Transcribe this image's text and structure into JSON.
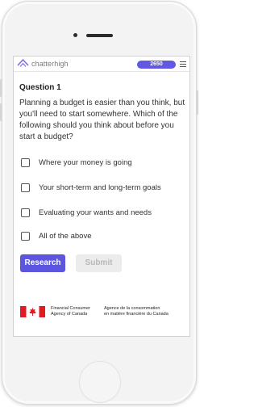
{
  "header": {
    "brand": "chatterhigh",
    "points": "2650",
    "logo_icon": "chatterhigh-logo-icon",
    "menu_icon": "hamburger-menu-icon"
  },
  "question": {
    "title": "Question 1",
    "text": "Planning a budget is easier than you think, but you'll need to start somewhere. Which of the following should you think about before you start a budget?",
    "options": [
      {
        "label": "Where your money is going",
        "checked": false
      },
      {
        "label": "Your short-term and long-term goals",
        "checked": false
      },
      {
        "label": "Evaluating your wants and needs",
        "checked": false
      },
      {
        "label": "All of the above",
        "checked": false
      }
    ]
  },
  "actions": {
    "research_label": "Research",
    "submit_label": "Submit"
  },
  "footer": {
    "flag_icon": "canada-flag-icon",
    "english_line1": "Financial Consumer",
    "english_line2": "Agency of Canada",
    "french_line1": "Agence de la consommation",
    "french_line2": "en matière financière du Canada"
  },
  "colors": {
    "accent": "#5c55e0",
    "points_badge": "#6259e3",
    "submit_disabled_bg": "#ececec",
    "submit_disabled_text": "#b8b8b8",
    "flag_red": "#e21b23"
  }
}
